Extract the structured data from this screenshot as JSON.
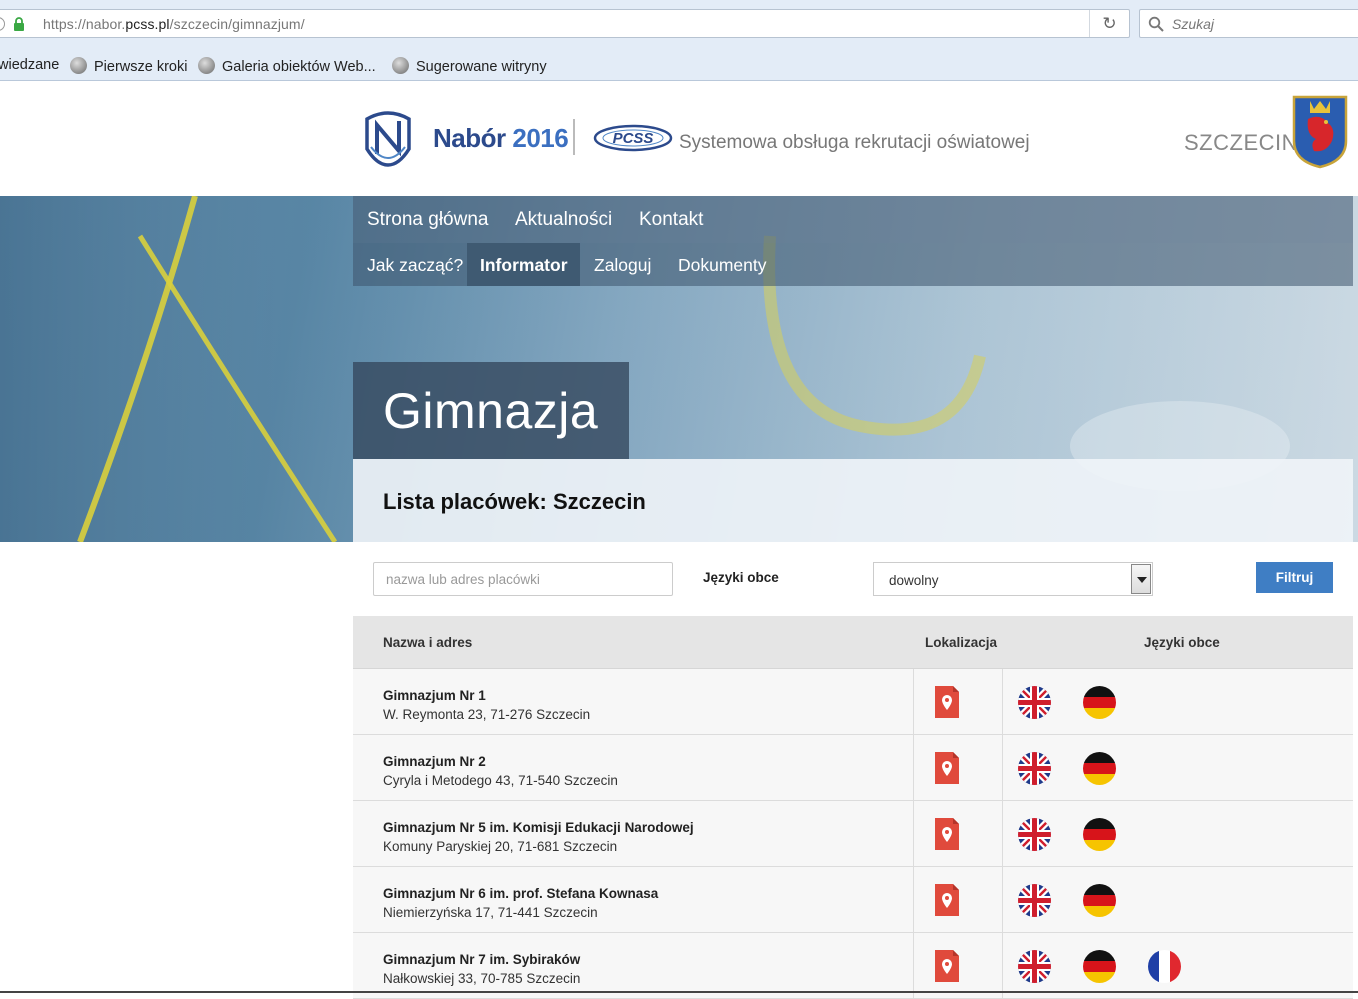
{
  "browser": {
    "url_prefix": "https://nabor.",
    "url_domain": "pcss.pl",
    "url_path": "/szczecin/gimnazjum/",
    "search_placeholder": "Szukaj",
    "bookmarks": [
      "wiedzane",
      "Pierwsze kroki",
      "Galeria obiektów Web...",
      "Sugerowane witryny"
    ]
  },
  "header": {
    "brand": "Nabór",
    "brand_year": "2016",
    "pcss_logo_text": "PCSS",
    "system_text": "Systemowa obsługa rekrutacji oświatowej",
    "city": "SZCZECIN"
  },
  "nav": {
    "main": [
      "Strona główna",
      "Aktualności",
      "Kontakt"
    ],
    "sub": [
      "Jak zacząć?",
      "Informator",
      "Zaloguj",
      "Dokumenty"
    ],
    "active_sub": "Informator"
  },
  "hero": {
    "title": "Gimnazja",
    "list_title": "Lista placówek: Szczecin"
  },
  "filter": {
    "search_placeholder": "nazwa lub adres placówki",
    "lang_label": "Języki obce",
    "lang_value": "dowolny",
    "button": "Filtruj"
  },
  "table": {
    "columns": [
      "Nazwa i adres",
      "Lokalizacja",
      "Języki obce"
    ],
    "rows": [
      {
        "name": "Gimnazjum Nr 1",
        "address": "W. Reymonta 23, 71-276 Szczecin",
        "languages": [
          "english-flag-icon",
          "german-flag-icon"
        ]
      },
      {
        "name": "Gimnazjum Nr 2",
        "address": "Cyryla i Metodego 43, 71-540 Szczecin",
        "languages": [
          "english-flag-icon",
          "german-flag-icon"
        ]
      },
      {
        "name": "Gimnazjum Nr 5 im. Komisji Edukacji Narodowej",
        "address": "Komuny Paryskiej 20, 71-681 Szczecin",
        "languages": [
          "english-flag-icon",
          "german-flag-icon"
        ]
      },
      {
        "name": "Gimnazjum Nr 6 im. prof. Stefana Kownasa",
        "address": "Niemierzyńska 17, 71-441 Szczecin",
        "languages": [
          "english-flag-icon",
          "german-flag-icon"
        ]
      },
      {
        "name": "Gimnazjum Nr 7 im. Sybiraków",
        "address": "Nałkowskiej 33, 70-785 Szczecin",
        "languages": [
          "english-flag-icon",
          "german-flag-icon",
          "french-flag-icon"
        ]
      }
    ]
  },
  "colors": {
    "accent": "#3f7ec4",
    "brand_navy": "#2c4a8c",
    "map_marker": "#e04a3c"
  }
}
